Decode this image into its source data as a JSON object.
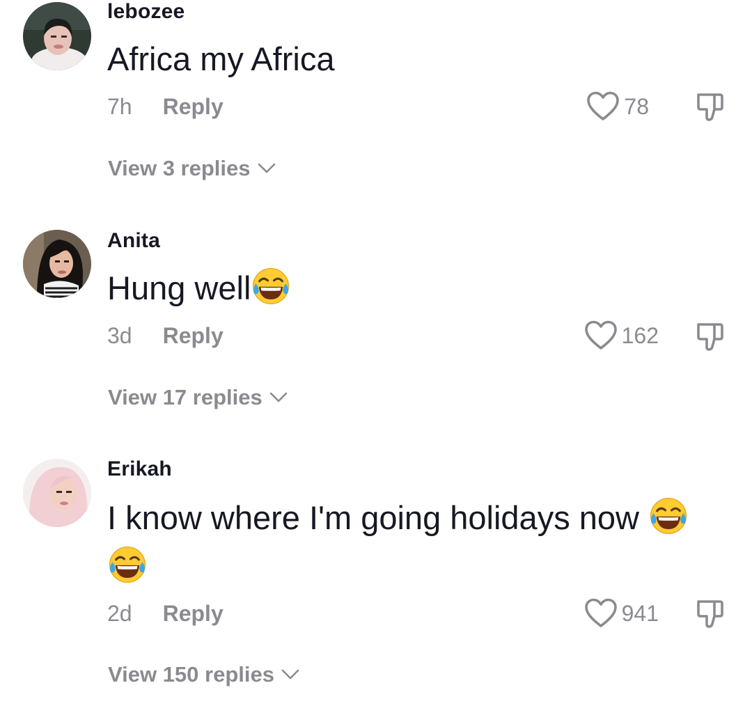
{
  "comments": [
    {
      "username": "lebozee",
      "text": "Africa my Africa",
      "emoji_count": 0,
      "time": "7h",
      "reply_label": "Reply",
      "likes": "78",
      "view_replies": "View 3 replies",
      "avatar_icon": "user-avatar-photo"
    },
    {
      "username": "Anita",
      "text": "Hung well",
      "emoji": "face-with-tears-of-joy",
      "time": "3d",
      "reply_label": "Reply",
      "likes": "162",
      "view_replies": "View 17 replies",
      "avatar_icon": "user-avatar-photo"
    },
    {
      "username": "Erikah",
      "text": "I know where I'm going holidays now",
      "emoji": "face-with-tears-of-joy",
      "time": "2d",
      "reply_label": "Reply",
      "likes": "941",
      "view_replies": "View 150 replies",
      "avatar_icon": "user-avatar-photo"
    }
  ],
  "colors": {
    "primary_text": "#161823",
    "secondary_text": "#8a8b91",
    "background": "#ffffff"
  }
}
